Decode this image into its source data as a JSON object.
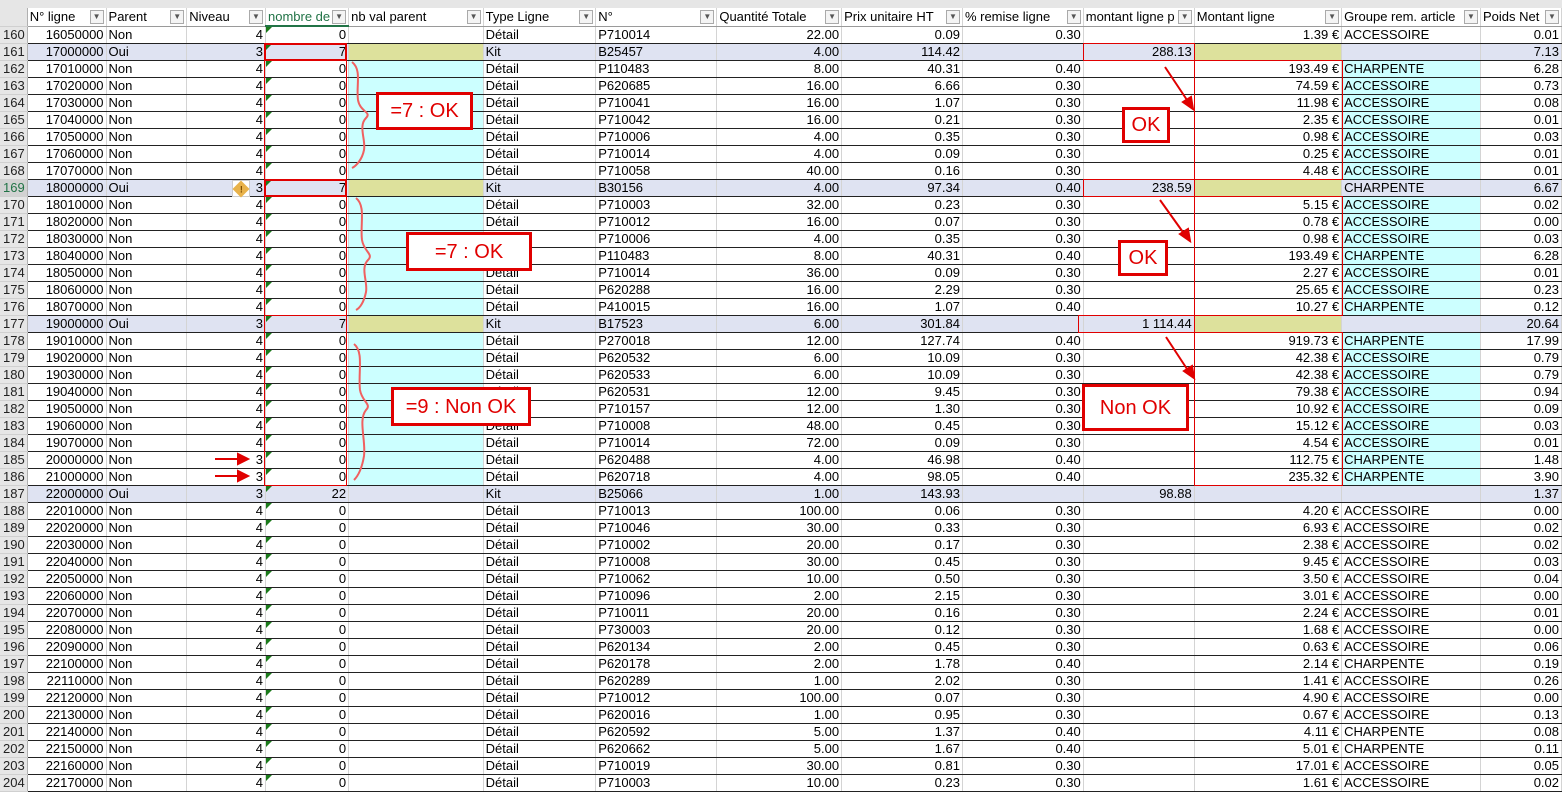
{
  "columns": [
    "N° ligne",
    "Parent",
    "Niveau",
    "nombre de",
    "nb val parent",
    "Type Ligne",
    "N°",
    "Quantité Totale",
    "Prix unitaire HT",
    "% remise ligne",
    "montant ligne p",
    "Montant ligne",
    "Groupe rem. article",
    "Poids Net"
  ],
  "rows": [
    [
      "160",
      "16050000",
      "Non",
      "4",
      "0",
      "",
      "Détail",
      "P710014",
      "22.00",
      "0.09",
      "0.30",
      "",
      "1.39 €",
      "ACCESSOIRE",
      "0.01"
    ],
    [
      "161",
      "17000000",
      "Oui",
      "3",
      "7",
      "",
      "Kit",
      "B25457",
      "4.00",
      "114.42",
      "",
      "288.13",
      "",
      "",
      "7.13"
    ],
    [
      "162",
      "17010000",
      "Non",
      "4",
      "0",
      "",
      "Détail",
      "P110483",
      "8.00",
      "40.31",
      "0.40",
      "",
      "193.49 €",
      "CHARPENTE",
      "6.28"
    ],
    [
      "163",
      "17020000",
      "Non",
      "4",
      "0",
      "",
      "Détail",
      "P620685",
      "16.00",
      "6.66",
      "0.30",
      "",
      "74.59 €",
      "ACCESSOIRE",
      "0.73"
    ],
    [
      "164",
      "17030000",
      "Non",
      "4",
      "0",
      "",
      "Détail",
      "P710041",
      "16.00",
      "1.07",
      "0.30",
      "",
      "11.98 €",
      "ACCESSOIRE",
      "0.08"
    ],
    [
      "165",
      "17040000",
      "Non",
      "4",
      "0",
      "",
      "Détail",
      "P710042",
      "16.00",
      "0.21",
      "0.30",
      "",
      "2.35 €",
      "ACCESSOIRE",
      "0.01"
    ],
    [
      "166",
      "17050000",
      "Non",
      "4",
      "0",
      "",
      "Détail",
      "P710006",
      "4.00",
      "0.35",
      "0.30",
      "",
      "0.98 €",
      "ACCESSOIRE",
      "0.03"
    ],
    [
      "167",
      "17060000",
      "Non",
      "4",
      "0",
      "",
      "Détail",
      "P710014",
      "4.00",
      "0.09",
      "0.30",
      "",
      "0.25 €",
      "ACCESSOIRE",
      "0.01"
    ],
    [
      "168",
      "17070000",
      "Non",
      "4",
      "0",
      "",
      "Détail",
      "P710058",
      "40.00",
      "0.16",
      "0.30",
      "",
      "4.48 €",
      "ACCESSOIRE",
      "0.01"
    ],
    [
      "169",
      "18000000",
      "Oui",
      "3",
      "7",
      "",
      "Kit",
      "B30156",
      "4.00",
      "97.34",
      "0.40",
      "238.59",
      "",
      "CHARPENTE",
      "6.67"
    ],
    [
      "170",
      "18010000",
      "Non",
      "4",
      "0",
      "",
      "Détail",
      "P710003",
      "32.00",
      "0.23",
      "0.30",
      "",
      "5.15 €",
      "ACCESSOIRE",
      "0.02"
    ],
    [
      "171",
      "18020000",
      "Non",
      "4",
      "0",
      "",
      "Détail",
      "P710012",
      "16.00",
      "0.07",
      "0.30",
      "",
      "0.78 €",
      "ACCESSOIRE",
      "0.00"
    ],
    [
      "172",
      "18030000",
      "Non",
      "4",
      "0",
      "",
      "Détail",
      "P710006",
      "4.00",
      "0.35",
      "0.30",
      "",
      "0.98 €",
      "ACCESSOIRE",
      "0.03"
    ],
    [
      "173",
      "18040000",
      "Non",
      "4",
      "0",
      "",
      "Détail",
      "P110483",
      "8.00",
      "40.31",
      "0.40",
      "",
      "193.49 €",
      "CHARPENTE",
      "6.28"
    ],
    [
      "174",
      "18050000",
      "Non",
      "4",
      "0",
      "",
      "Détail",
      "P710014",
      "36.00",
      "0.09",
      "0.30",
      "",
      "2.27 €",
      "ACCESSOIRE",
      "0.01"
    ],
    [
      "175",
      "18060000",
      "Non",
      "4",
      "0",
      "",
      "Détail",
      "P620288",
      "16.00",
      "2.29",
      "0.30",
      "",
      "25.65 €",
      "ACCESSOIRE",
      "0.23"
    ],
    [
      "176",
      "18070000",
      "Non",
      "4",
      "0",
      "",
      "Détail",
      "P410015",
      "16.00",
      "1.07",
      "0.40",
      "",
      "10.27 €",
      "CHARPENTE",
      "0.12"
    ],
    [
      "177",
      "19000000",
      "Oui",
      "3",
      "7",
      "",
      "Kit",
      "B17523",
      "6.00",
      "301.84",
      "",
      "1 114.44",
      "",
      "",
      "20.64"
    ],
    [
      "178",
      "19010000",
      "Non",
      "4",
      "0",
      "",
      "Détail",
      "P270018",
      "12.00",
      "127.74",
      "0.40",
      "",
      "919.73 €",
      "CHARPENTE",
      "17.99"
    ],
    [
      "179",
      "19020000",
      "Non",
      "4",
      "0",
      "",
      "Détail",
      "P620532",
      "6.00",
      "10.09",
      "0.30",
      "",
      "42.38 €",
      "ACCESSOIRE",
      "0.79"
    ],
    [
      "180",
      "19030000",
      "Non",
      "4",
      "0",
      "",
      "Détail",
      "P620533",
      "6.00",
      "10.09",
      "0.30",
      "",
      "42.38 €",
      "ACCESSOIRE",
      "0.79"
    ],
    [
      "181",
      "19040000",
      "Non",
      "4",
      "0",
      "",
      "Détail",
      "P620531",
      "12.00",
      "9.45",
      "0.30",
      "",
      "79.38 €",
      "ACCESSOIRE",
      "0.94"
    ],
    [
      "182",
      "19050000",
      "Non",
      "4",
      "0",
      "",
      "Détail",
      "P710157",
      "12.00",
      "1.30",
      "0.30",
      "",
      "10.92 €",
      "ACCESSOIRE",
      "0.09"
    ],
    [
      "183",
      "19060000",
      "Non",
      "4",
      "0",
      "",
      "Détail",
      "P710008",
      "48.00",
      "0.45",
      "0.30",
      "",
      "15.12 €",
      "ACCESSOIRE",
      "0.03"
    ],
    [
      "184",
      "19070000",
      "Non",
      "4",
      "0",
      "",
      "Détail",
      "P710014",
      "72.00",
      "0.09",
      "0.30",
      "",
      "4.54 €",
      "ACCESSOIRE",
      "0.01"
    ],
    [
      "185",
      "20000000",
      "Non",
      "3",
      "0",
      "",
      "Détail",
      "P620488",
      "4.00",
      "46.98",
      "0.40",
      "",
      "112.75 €",
      "CHARPENTE",
      "1.48"
    ],
    [
      "186",
      "21000000",
      "Non",
      "3",
      "0",
      "",
      "Détail",
      "P620718",
      "4.00",
      "98.05",
      "0.40",
      "",
      "235.32 €",
      "CHARPENTE",
      "3.90"
    ],
    [
      "187",
      "22000000",
      "Oui",
      "3",
      "22",
      "",
      "Kit",
      "B25066",
      "1.00",
      "143.93",
      "",
      "98.88",
      "",
      "",
      "1.37"
    ],
    [
      "188",
      "22010000",
      "Non",
      "4",
      "0",
      "",
      "Détail",
      "P710013",
      "100.00",
      "0.06",
      "0.30",
      "",
      "4.20 €",
      "ACCESSOIRE",
      "0.00"
    ],
    [
      "189",
      "22020000",
      "Non",
      "4",
      "0",
      "",
      "Détail",
      "P710046",
      "30.00",
      "0.33",
      "0.30",
      "",
      "6.93 €",
      "ACCESSOIRE",
      "0.02"
    ],
    [
      "190",
      "22030000",
      "Non",
      "4",
      "0",
      "",
      "Détail",
      "P710002",
      "20.00",
      "0.17",
      "0.30",
      "",
      "2.38 €",
      "ACCESSOIRE",
      "0.02"
    ],
    [
      "191",
      "22040000",
      "Non",
      "4",
      "0",
      "",
      "Détail",
      "P710008",
      "30.00",
      "0.45",
      "0.30",
      "",
      "9.45 €",
      "ACCESSOIRE",
      "0.03"
    ],
    [
      "192",
      "22050000",
      "Non",
      "4",
      "0",
      "",
      "Détail",
      "P710062",
      "10.00",
      "0.50",
      "0.30",
      "",
      "3.50 €",
      "ACCESSOIRE",
      "0.04"
    ],
    [
      "193",
      "22060000",
      "Non",
      "4",
      "0",
      "",
      "Détail",
      "P710096",
      "2.00",
      "2.15",
      "0.30",
      "",
      "3.01 €",
      "ACCESSOIRE",
      "0.00"
    ],
    [
      "194",
      "22070000",
      "Non",
      "4",
      "0",
      "",
      "Détail",
      "P710011",
      "20.00",
      "0.16",
      "0.30",
      "",
      "2.24 €",
      "ACCESSOIRE",
      "0.01"
    ],
    [
      "195",
      "22080000",
      "Non",
      "4",
      "0",
      "",
      "Détail",
      "P730003",
      "20.00",
      "0.12",
      "0.30",
      "",
      "1.68 €",
      "ACCESSOIRE",
      "0.00"
    ],
    [
      "196",
      "22090000",
      "Non",
      "4",
      "0",
      "",
      "Détail",
      "P620134",
      "2.00",
      "0.45",
      "0.30",
      "",
      "0.63 €",
      "ACCESSOIRE",
      "0.06"
    ],
    [
      "197",
      "22100000",
      "Non",
      "4",
      "0",
      "",
      "Détail",
      "P620178",
      "2.00",
      "1.78",
      "0.40",
      "",
      "2.14 €",
      "CHARPENTE",
      "0.19"
    ],
    [
      "198",
      "22110000",
      "Non",
      "4",
      "0",
      "",
      "Détail",
      "P620289",
      "1.00",
      "2.02",
      "0.30",
      "",
      "1.41 €",
      "ACCESSOIRE",
      "0.26"
    ],
    [
      "199",
      "22120000",
      "Non",
      "4",
      "0",
      "",
      "Détail",
      "P710012",
      "100.00",
      "0.07",
      "0.30",
      "",
      "4.90 €",
      "ACCESSOIRE",
      "0.00"
    ],
    [
      "200",
      "22130000",
      "Non",
      "4",
      "0",
      "",
      "Détail",
      "P620016",
      "1.00",
      "0.95",
      "0.30",
      "",
      "0.67 €",
      "ACCESSOIRE",
      "0.13"
    ],
    [
      "201",
      "22140000",
      "Non",
      "4",
      "0",
      "",
      "Détail",
      "P620592",
      "5.00",
      "1.37",
      "0.40",
      "",
      "4.11 €",
      "CHARPENTE",
      "0.08"
    ],
    [
      "202",
      "22150000",
      "Non",
      "4",
      "0",
      "",
      "Détail",
      "P620662",
      "5.00",
      "1.67",
      "0.40",
      "",
      "5.01 €",
      "CHARPENTE",
      "0.11"
    ],
    [
      "203",
      "22160000",
      "Non",
      "4",
      "0",
      "",
      "Détail",
      "P710019",
      "30.00",
      "0.81",
      "0.30",
      "",
      "17.01 €",
      "ACCESSOIRE",
      "0.05"
    ],
    [
      "204",
      "22170000",
      "Non",
      "4",
      "0",
      "",
      "Détail",
      "P710003",
      "10.00",
      "0.23",
      "0.30",
      "",
      "1.61 €",
      "ACCESSOIRE",
      "0.02"
    ]
  ],
  "annotations": {
    "a1": "=7 : OK",
    "a2": "OK",
    "a3": "=7 : OK",
    "a4": "OK",
    "a5": "=9 : Non OK",
    "a6": "Non OK"
  },
  "colors": {
    "kit_row": "#dfe3f2",
    "kit_highlight": "#dde19c",
    "child_highlight": "#ccffff",
    "annotation": "#e00000"
  }
}
